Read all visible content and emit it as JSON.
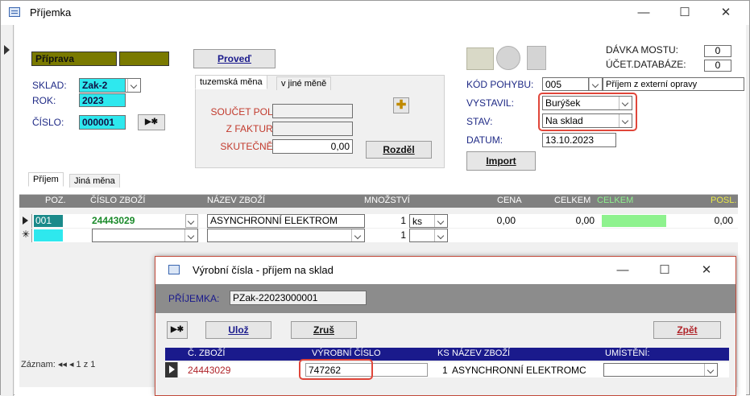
{
  "window": {
    "title": "Příjemka",
    "min": "—",
    "max": "☐",
    "close": "✕"
  },
  "left": {
    "priprava": "Příprava",
    "sklad_label": "SKLAD:",
    "sklad_value": "Zak-2",
    "rok_label": "ROK:",
    "rok_value": "2023",
    "cislo_label": "ČÍSLO:",
    "cislo_value": "000001",
    "new_record": "▶✱"
  },
  "proved": "Proveď",
  "tabs_top": [
    "tuzemská měna",
    "v jiné měně"
  ],
  "sums": {
    "soucet_label": "SOUČET POL:",
    "zfaktur_label": "Z FAKTUR:",
    "skutecne_label": "SKUTEČNĚ:",
    "skutecne_value": "0,00",
    "rozdel": "Rozděl"
  },
  "right": {
    "davka_label": "DÁVKA MOSTU:",
    "davka_value": "0",
    "ucet_label": "ÚČET.DATABÁZE:",
    "ucet_value": "0",
    "kod_label": "KÓD POHYBU:",
    "kod_value": "005",
    "kod_desc": "Příjem z externí opravy",
    "vystavil_label": "VYSTAVIL:",
    "vystavil_value": "Burýšek",
    "stav_label": "STAV:",
    "stav_value": "Na sklad",
    "datum_label": "DATUM:",
    "datum_value": "13.10.2023",
    "import": "Import"
  },
  "tabs_bottom": [
    "Příjem",
    "Jiná měna"
  ],
  "grid": {
    "headers": [
      "POZ.",
      "ČÍSLO ZBOŽÍ",
      "NÁZEV ZBOŽÍ",
      "MNOŽSTVÍ",
      "CENA",
      "CELKEM",
      "CELKEM",
      "POSL."
    ],
    "row1": {
      "poz": "001",
      "cislo": "24443029",
      "nazev": "ASYNCHRONNÍ ELEKTROM",
      "mnozstvi": "1",
      "unit": "ks",
      "cena": "0,00",
      "celkem": "0,00",
      "posl": "0,00"
    },
    "row2": {
      "mnozstvi": "1"
    },
    "record_nav": "Záznam: ◂◂  ◂  1 z 1",
    "new_star": "✳"
  },
  "subform": {
    "title": "Výrobní čísla - příjem na sklad",
    "prijemka_label": "PŘÍJEMKA:",
    "prijemka_value": "PZak-22023000001",
    "new": "▶✱",
    "uloz": "Ulož",
    "zrus": "Zruš",
    "zpet": "Zpět",
    "headers": [
      "Č. ZBOŽÍ",
      "VÝROBNÍ ČÍSLO",
      "KS",
      "NÁZEV ZBOŽÍ",
      "UMÍSTĚNÍ:"
    ],
    "row": {
      "zbozi": "24443029",
      "vyrobni": "747262",
      "ks": "1",
      "nazev": "ASYNCHRONNÍ ELEKTROMC"
    }
  },
  "colors": {
    "accent_red": "#e0463a",
    "cyan": "#2ee8ee",
    "olive": "#7a7a00",
    "green_cell": "#8ef28e",
    "navy": "#1a1a8c"
  }
}
